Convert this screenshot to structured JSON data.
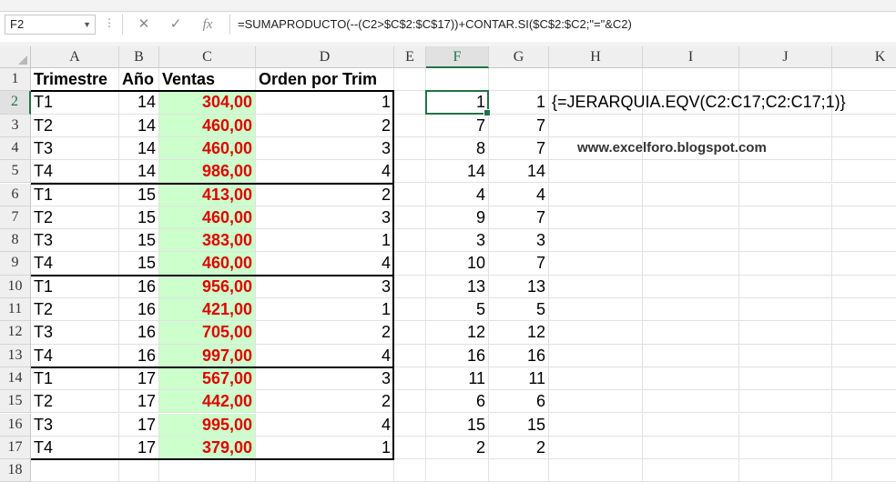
{
  "name_box": "F2",
  "formula_bar": {
    "cancel_glyph": "✕",
    "enter_glyph": "✓",
    "fx_glyph": "fx",
    "formula": "=SUMAPRODUCTO(--(C2>$C$2:$C$17))+CONTAR.SI($C$2:$C2;\"=\"&C2)"
  },
  "columns": [
    "A",
    "B",
    "C",
    "D",
    "E",
    "F",
    "G",
    "H",
    "I",
    "J",
    "K"
  ],
  "rows": [
    "1",
    "2",
    "3",
    "4",
    "5",
    "6",
    "7",
    "8",
    "9",
    "10",
    "11",
    "12",
    "13",
    "14",
    "15",
    "16",
    "17",
    "18"
  ],
  "headers": {
    "trimestre": "Trimestre",
    "anio": "Año",
    "ventas": "Ventas",
    "orden": "Orden por Trim"
  },
  "data": [
    {
      "trim": "T1",
      "anio": "14",
      "ventas": "304,00",
      "orden": "1",
      "f": "1",
      "g": "1"
    },
    {
      "trim": "T2",
      "anio": "14",
      "ventas": "460,00",
      "orden": "2",
      "f": "7",
      "g": "7"
    },
    {
      "trim": "T3",
      "anio": "14",
      "ventas": "460,00",
      "orden": "3",
      "f": "8",
      "g": "7"
    },
    {
      "trim": "T4",
      "anio": "14",
      "ventas": "986,00",
      "orden": "4",
      "f": "14",
      "g": "14"
    },
    {
      "trim": "T1",
      "anio": "15",
      "ventas": "413,00",
      "orden": "2",
      "f": "4",
      "g": "4"
    },
    {
      "trim": "T2",
      "anio": "15",
      "ventas": "460,00",
      "orden": "3",
      "f": "9",
      "g": "7"
    },
    {
      "trim": "T3",
      "anio": "15",
      "ventas": "383,00",
      "orden": "1",
      "f": "3",
      "g": "3"
    },
    {
      "trim": "T4",
      "anio": "15",
      "ventas": "460,00",
      "orden": "4",
      "f": "10",
      "g": "7"
    },
    {
      "trim": "T1",
      "anio": "16",
      "ventas": "956,00",
      "orden": "3",
      "f": "13",
      "g": "13"
    },
    {
      "trim": "T2",
      "anio": "16",
      "ventas": "421,00",
      "orden": "1",
      "f": "5",
      "g": "5"
    },
    {
      "trim": "T3",
      "anio": "16",
      "ventas": "705,00",
      "orden": "2",
      "f": "12",
      "g": "12"
    },
    {
      "trim": "T4",
      "anio": "16",
      "ventas": "997,00",
      "orden": "4",
      "f": "16",
      "g": "16"
    },
    {
      "trim": "T1",
      "anio": "17",
      "ventas": "567,00",
      "orden": "3",
      "f": "11",
      "g": "11"
    },
    {
      "trim": "T2",
      "anio": "17",
      "ventas": "442,00",
      "orden": "2",
      "f": "6",
      "g": "6"
    },
    {
      "trim": "T3",
      "anio": "17",
      "ventas": "995,00",
      "orden": "4",
      "f": "15",
      "g": "15"
    },
    {
      "trim": "T4",
      "anio": "17",
      "ventas": "379,00",
      "orden": "1",
      "f": "2",
      "g": "2"
    }
  ],
  "note_formula": "{=JERARQUIA.EQV(C2:C17;C2:C17;1)}",
  "watermark": "www.excelforo.blogspot.com",
  "selected_cell": "F2",
  "colors": {
    "sales_fill": "#ccffcc",
    "sales_text": "#e00000",
    "excel_green": "#217346"
  }
}
